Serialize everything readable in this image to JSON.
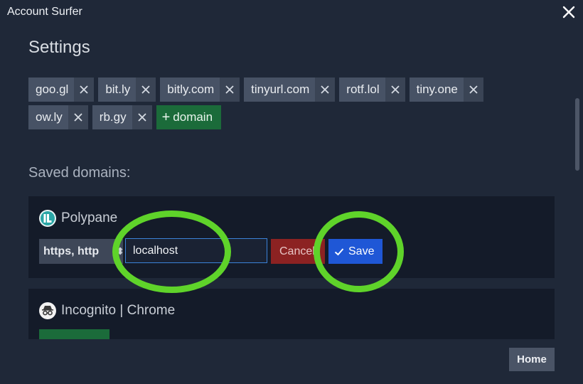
{
  "window": {
    "title": "Account Surfer"
  },
  "settings": {
    "title": "Settings"
  },
  "shortener_domains": [
    {
      "label": "goo.gl"
    },
    {
      "label": "bit.ly"
    },
    {
      "label": "bitly.com"
    },
    {
      "label": "tinyurl.com"
    },
    {
      "label": "rotf.lol"
    },
    {
      "label": "tiny.one"
    },
    {
      "label": "ow.ly"
    },
    {
      "label": "rb.gy"
    }
  ],
  "add_domain_label": "domain",
  "saved_domains": {
    "title": "Saved domains:",
    "items": [
      {
        "name": "Polypane",
        "icon": "polypane-icon",
        "protocol": "https, http",
        "domain_value": "localhost",
        "cancel_label": "Cancel",
        "save_label": "Save"
      },
      {
        "name": "Incognito | Chrome",
        "icon": "incognito-icon"
      }
    ]
  },
  "footer": {
    "home_label": "Home"
  },
  "colors": {
    "background": "#1f2838",
    "card": "#141b29",
    "chip": "#475265",
    "add": "#1b6b3a",
    "cancel": "#8c2222",
    "save": "#1f57d6",
    "highlight": "#5fd32a"
  }
}
